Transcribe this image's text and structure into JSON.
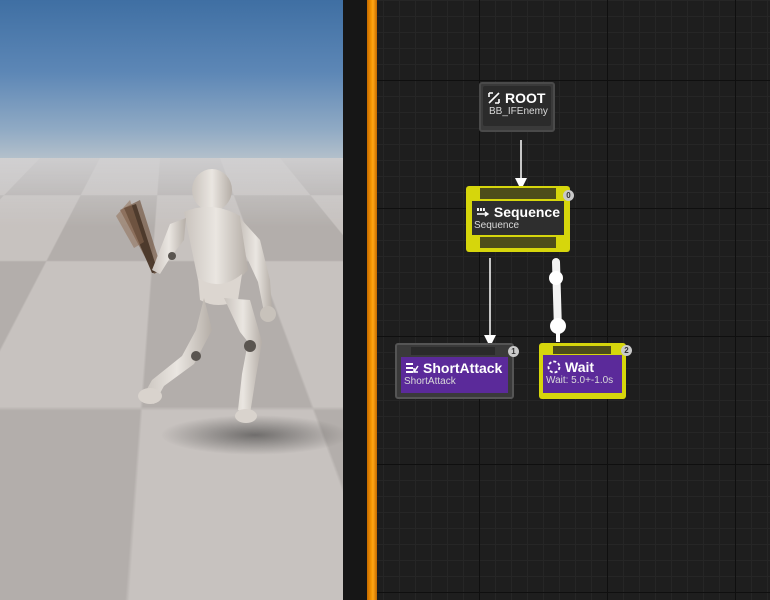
{
  "viewport": {
    "sky_color": "#5d87b6",
    "floor_colors": [
      "#c7c2bf",
      "#b3aeab"
    ]
  },
  "graph": {
    "background_color": "#1e1e1e",
    "exec_bar_color": "#f39300",
    "nodes": {
      "root": {
        "title": "ROOT",
        "subtitle": "BB_IFEnemy",
        "icon": "root-icon"
      },
      "sequence": {
        "title": "Sequence",
        "subtitle": "Sequence",
        "icon": "sequence-icon",
        "badge": "0",
        "color": "#d6d60c"
      },
      "short_attack": {
        "title": "ShortAttack",
        "subtitle": "ShortAttack",
        "icon": "task-icon",
        "badge": "1",
        "color": "#5b2a9a"
      },
      "wait": {
        "title": "Wait",
        "subtitle": "Wait: 5.0+-1.0s",
        "icon": "wait-icon",
        "badge": "2",
        "color": "#5b2a9a",
        "highlight_color": "#d6d60c"
      }
    }
  }
}
